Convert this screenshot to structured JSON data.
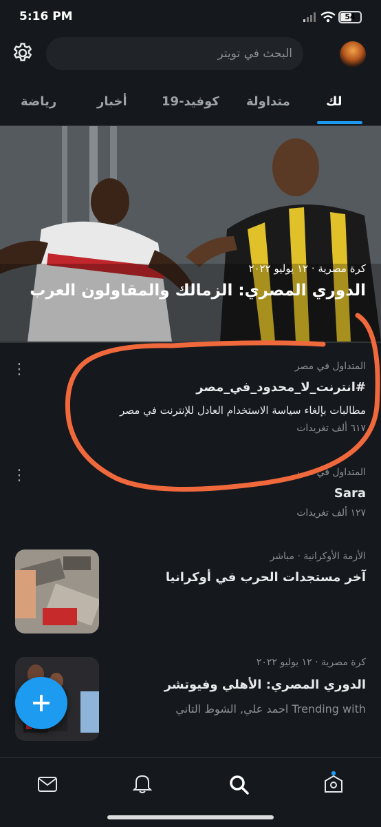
{
  "status_bar": {
    "time": "5:16 PM",
    "battery": "54"
  },
  "search": {
    "placeholder": "البحث في تويتر"
  },
  "tabs": [
    {
      "label": "لك",
      "active": true
    },
    {
      "label": "متداولة",
      "active": false
    },
    {
      "label": "كوفيد-19",
      "active": false
    },
    {
      "label": "أخبار",
      "active": false
    },
    {
      "label": "رياضة",
      "active": false
    }
  ],
  "hero": {
    "meta": "كرة مصرية · ١٢ يوليو ٢٠٢٢",
    "title": "الدوري المصري: الزمالك والمقاولون العرب"
  },
  "trends": [
    {
      "context": "المتداول في مصر",
      "title": "#انترنت_لا_محدود_في_مصر",
      "description": "مطالبات بإلغاء سياسة الاستخدام العادل للإنترنت في مصر",
      "count": "٦١٧ ألف تغريدات"
    },
    {
      "context": "المتداول في مصر",
      "title": "Sara",
      "count": "١٢٧ ألف تغريدات"
    }
  ],
  "news": [
    {
      "meta": "الأزمة الأوكرانية · مباشر",
      "title": "آخر مستجدات الحرب في أوكرانيا"
    },
    {
      "meta": "كرة مصرية · ١٢ يوليو ٢٠٢٢",
      "title": "الدوري المصري: الأهلي وفيوتشر",
      "footer": "احمد علي, الشوط التاني Trending with"
    }
  ],
  "colors": {
    "accent": "#1d9bf0",
    "background": "#15181c",
    "annotation": "#f0693c"
  }
}
